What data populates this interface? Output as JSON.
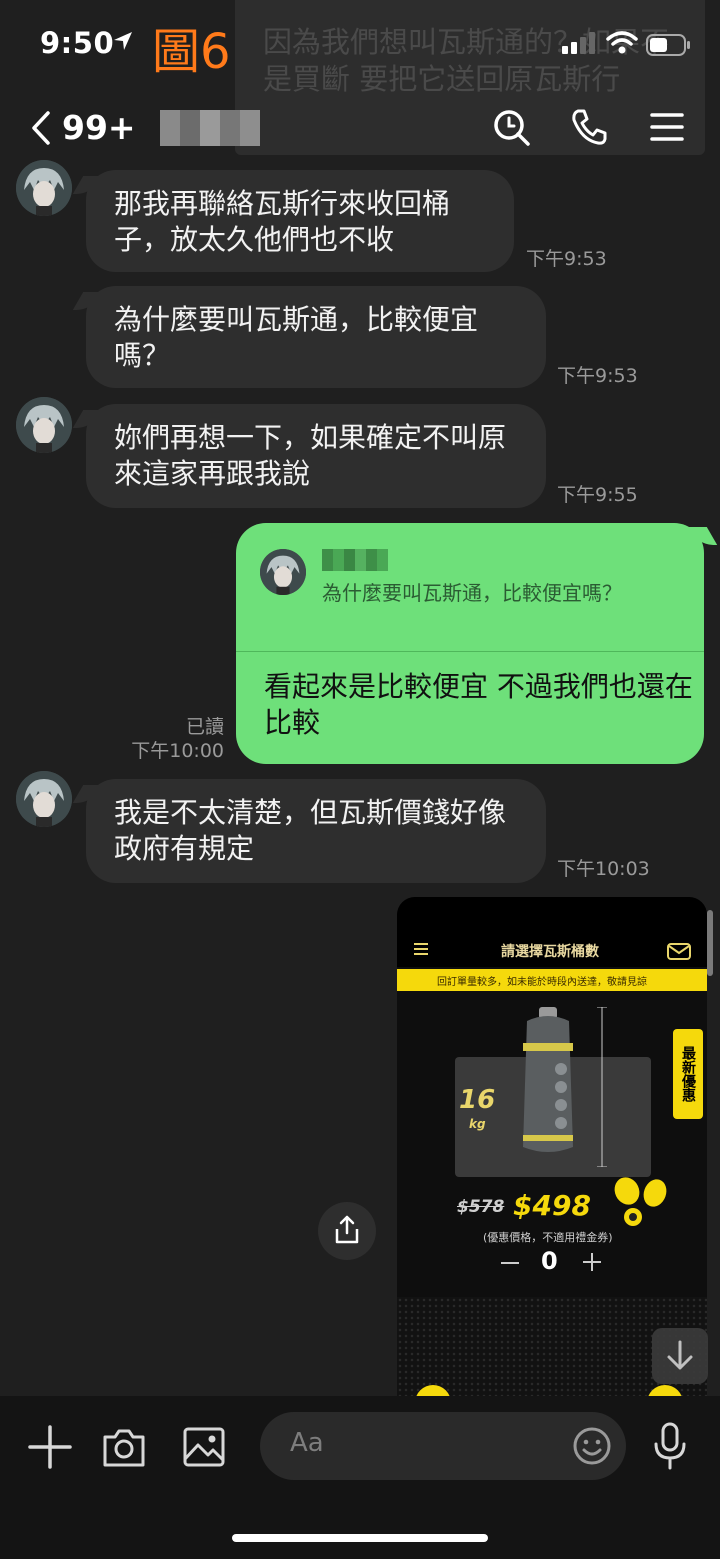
{
  "status_bar": {
    "time": "9:50"
  },
  "figure_label": "圖6",
  "notification": {
    "text": "因為我們想叫瓦斯通的？如果不是買斷 要把它送回原瓦斯行"
  },
  "header": {
    "back_count": "99+",
    "contact_name": ""
  },
  "messages": [
    {
      "direction": "in",
      "text": "那我再聯絡瓦斯行來收回桶子，放太久他們也不收",
      "time": "下午9:53"
    },
    {
      "direction": "in",
      "text": "為什麼要叫瓦斯通，比較便宜嗎？",
      "time": "下午9:53"
    },
    {
      "direction": "in",
      "text": "妳們再想一下，如果確定不叫原來這家再跟我說",
      "time": "下午9:55"
    },
    {
      "direction": "out",
      "reply_to": "為什麼要叫瓦斯通，比較便宜嗎？",
      "text": "看起來是比較便宜 不過我們也還在比較",
      "read": "已讀",
      "time": "下午10:00"
    },
    {
      "direction": "in",
      "text": "我是不太清楚，但瓦斯價錢好像政府有規定",
      "time": "下午10:03"
    }
  ],
  "image_message": {
    "title": "請選擇瓦斯桶數",
    "banner": "回訂單量較多，如未能於時段內送達，敬請見諒",
    "side_tag": "最新優惠",
    "weight": "16",
    "weight_unit": "kg",
    "old_price": "$578",
    "new_price": "$498",
    "price_note": "(優惠價格，不適用禮金券)",
    "quantity": "0"
  },
  "composer": {
    "placeholder": "Aa"
  },
  "colors": {
    "outgoing_bubble": "#6ee07a",
    "incoming_bubble": "#2e2e2e",
    "background": "#1f1f1f",
    "figure_label": "#ff7a1a"
  },
  "icons": [
    "location-arrow-icon",
    "signal-icon",
    "wifi-icon",
    "battery-icon",
    "back-chevron-icon",
    "search-icon",
    "phone-icon",
    "menu-icon",
    "share-icon",
    "scroll-down-icon",
    "plus-icon",
    "camera-icon",
    "gallery-icon",
    "emoji-icon",
    "microphone-icon"
  ]
}
